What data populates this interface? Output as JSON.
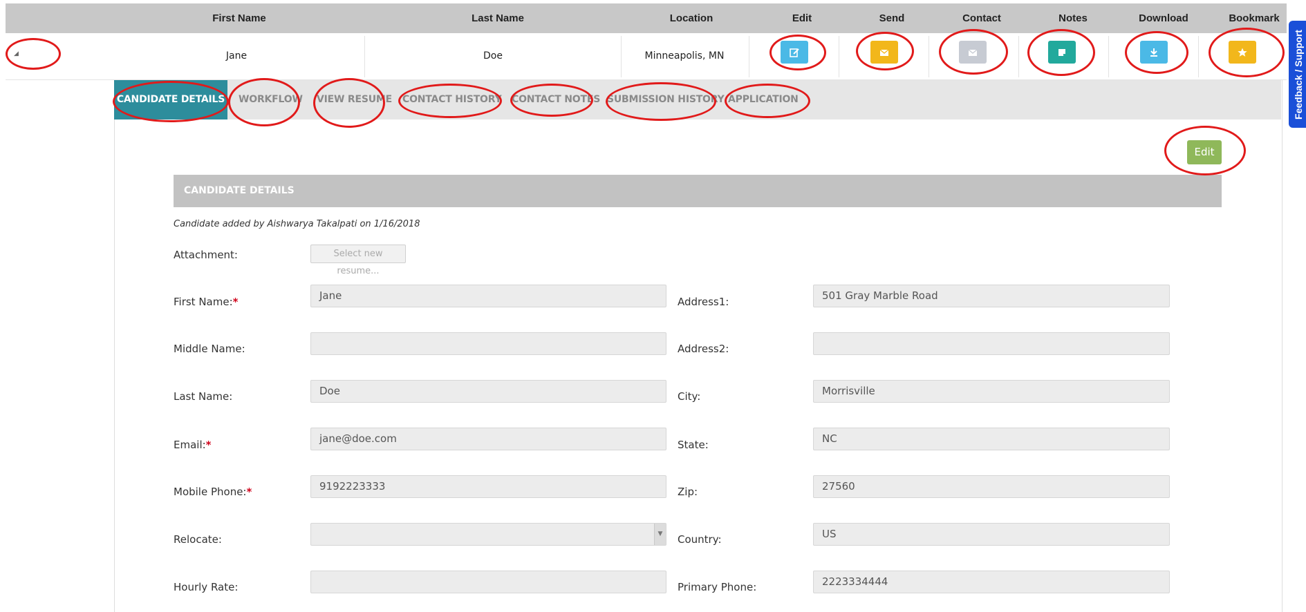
{
  "grid": {
    "columns": [
      "First Name",
      "Last Name",
      "Location",
      "Edit",
      "Send",
      "Contact",
      "Notes",
      "Download",
      "Bookmark"
    ],
    "row": {
      "first_name": "Jane",
      "last_name": "Doe",
      "location": "Minneapolis, MN"
    }
  },
  "tabs": [
    {
      "label": "CANDIDATE DETAILS"
    },
    {
      "label": "WORKFLOW"
    },
    {
      "label": "VIEW RESUME"
    },
    {
      "label": "CONTACT HISTORY"
    },
    {
      "label": "CONTACT NOTES"
    },
    {
      "label": "SUBMISSION HISTORY"
    },
    {
      "label": "APPLICATION"
    }
  ],
  "edit_button": "Edit",
  "section_title": "CANDIDATE DETAILS",
  "added_note": "Candidate added by Aishwarya Takalpati on 1/16/2018",
  "attachment": {
    "label": "Attachment:",
    "button": "Select new resume..."
  },
  "left_fields": [
    {
      "label": "First Name:",
      "value": "Jane",
      "required": "*"
    },
    {
      "label": "Middle Name:",
      "value": ""
    },
    {
      "label": "Last Name:",
      "value": "Doe"
    },
    {
      "label": "Email:",
      "value": "jane@doe.com",
      "required": "*"
    },
    {
      "label": "Mobile Phone:",
      "value": "9192223333",
      "required": "*"
    },
    {
      "label": "Relocate:",
      "value": ""
    },
    {
      "label": "Hourly Rate:",
      "value": ""
    }
  ],
  "right_fields": [
    {
      "label": "Address1:",
      "value": "501 Gray Marble Road"
    },
    {
      "label": "Address2:",
      "value": ""
    },
    {
      "label": "City:",
      "value": "Morrisville"
    },
    {
      "label": "State:",
      "value": "NC"
    },
    {
      "label": "Zip:",
      "value": "27560"
    },
    {
      "label": "Country:",
      "value": "US"
    },
    {
      "label": "Primary Phone:",
      "value": "2223334444"
    }
  ],
  "feedback": "Feedback / Support",
  "colors": {
    "tab_active": "#2d8d9c",
    "edit_btn": "#8fb85a",
    "edit_icon": "#4bb9e6",
    "send_icon": "#f2b71b",
    "contact_icon": "#c7cbd3",
    "notes_icon": "#22a99c",
    "download_icon": "#4bb9e6",
    "bookmark_icon": "#f2b71b",
    "feedback": "#1a4fd8",
    "annotation": "#e11a1a"
  },
  "icons": [
    "edit-icon",
    "envelope-icon",
    "envelope-icon",
    "note-icon",
    "download-icon",
    "star-icon"
  ]
}
